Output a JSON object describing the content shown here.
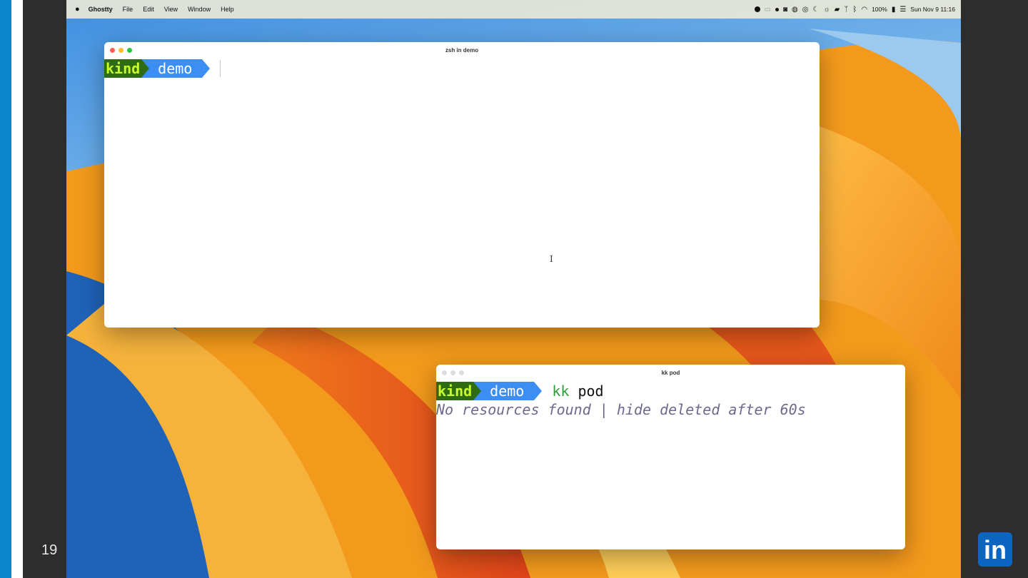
{
  "slide": {
    "number": "19",
    "logo_text": "in"
  },
  "menubar": {
    "app_name": "Ghostty",
    "menus": [
      "File",
      "Edit",
      "View",
      "Window",
      "Help"
    ],
    "battery": "100%",
    "datetime": "Sun Nov 9  11:16"
  },
  "window_top": {
    "title": "zsh in demo",
    "prompt": {
      "context": "kind",
      "namespace": "demo"
    }
  },
  "window_bottom": {
    "title": "kk pod",
    "prompt": {
      "context": "kind",
      "namespace": "demo"
    },
    "command": "kk",
    "argument": "pod",
    "output": "No resources found | hide deleted after 60s"
  },
  "colors": {
    "slide_accent": "#0b86cf",
    "kind_bg": "#2e6b12",
    "kind_fg": "#c8ff2e",
    "demo_bg": "#3d8ef2",
    "command": "#2f9e3a",
    "output": "#6b6a8e"
  }
}
